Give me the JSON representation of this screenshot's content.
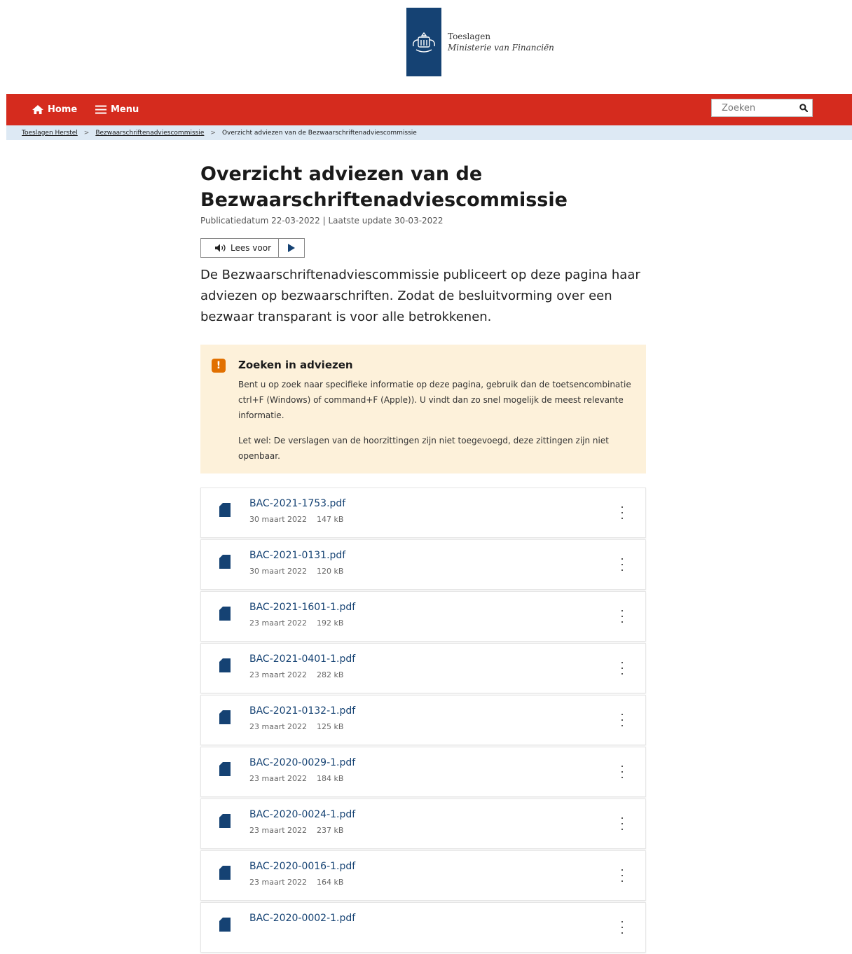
{
  "logo": {
    "line1": "Toeslagen",
    "line2": "Ministerie van Financiën",
    "color": "#154273"
  },
  "nav": {
    "home_label": "Home",
    "menu_label": "Menu",
    "search_placeholder": "Zoeken",
    "bar_color": "#d52b1e"
  },
  "breadcrumb": {
    "items": [
      "Toeslagen Herstel",
      "Bezwaarschriftenadviescommissie"
    ],
    "current": "Overzicht adviezen van de Bezwaarschriftenadviescommissie"
  },
  "page": {
    "title": "Overzicht adviezen van de Bezwaarschriftenadviescommissie",
    "pubdate": "Publicatiedatum 22-03-2022 | Laatste update 30-03-2022",
    "readspeaker_label": "Lees voor",
    "intro": "De Bezwaarschriftenadviescommissie publiceert op deze pagina haar adviezen op bezwaarschriften. Zodat de besluitvorming over een bezwaar transparant is voor alle betrokkenen."
  },
  "notice": {
    "badge": "!",
    "title": "Zoeken in adviezen",
    "paragraph1": "Bent u op zoek naar specifieke informatie op deze pagina, gebruik dan de toetsencombinatie ctrl+F (Windows) of command+F (Apple)). U vindt dan zo snel mogelijk de meest relevante informatie.",
    "paragraph2": "Let wel: De verslagen van de hoorzittingen zijn niet toegevoegd, deze zittingen zijn niet openbaar.",
    "background": "#fdf1da",
    "accent": "#e17000"
  },
  "files": [
    {
      "name": "BAC-2021-1753.pdf",
      "date": "30 maart 2022",
      "size": "147 kB"
    },
    {
      "name": "BAC-2021-0131.pdf",
      "date": "30 maart 2022",
      "size": "120 kB"
    },
    {
      "name": "BAC-2021-1601-1.pdf",
      "date": "23 maart 2022",
      "size": "192 kB"
    },
    {
      "name": "BAC-2021-0401-1.pdf",
      "date": "23 maart 2022",
      "size": "282 kB"
    },
    {
      "name": "BAC-2021-0132-1.pdf",
      "date": "23 maart 2022",
      "size": "125 kB"
    },
    {
      "name": "BAC-2020-0029-1.pdf",
      "date": "23 maart 2022",
      "size": "184 kB"
    },
    {
      "name": "BAC-2020-0024-1.pdf",
      "date": "23 maart 2022",
      "size": "237 kB"
    },
    {
      "name": "BAC-2020-0016-1.pdf",
      "date": "23 maart 2022",
      "size": "164 kB"
    },
    {
      "name": "BAC-2020-0002-1.pdf",
      "date": "",
      "size": ""
    }
  ]
}
